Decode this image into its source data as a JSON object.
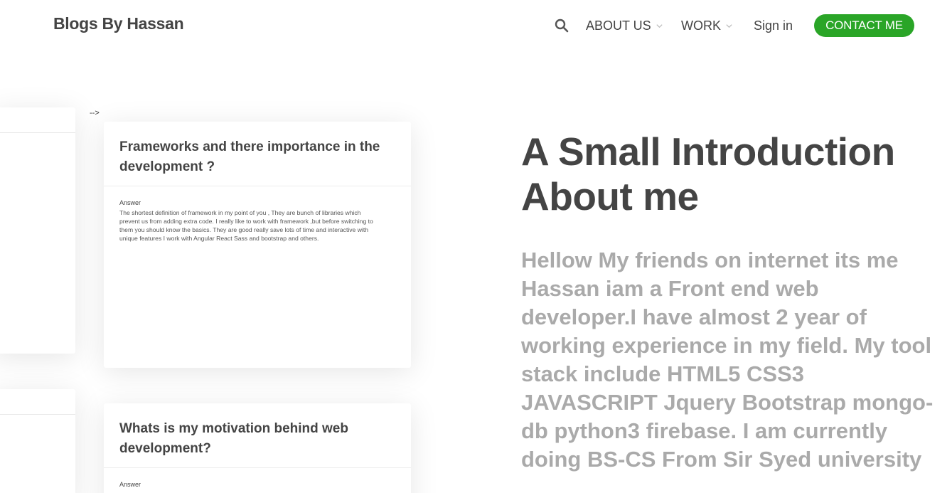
{
  "header": {
    "brand": "Blogs By Hassan",
    "nav": {
      "about": "ABOUT US",
      "work": "WORK",
      "signin": "Sign in",
      "contact": "CONTACT ME"
    }
  },
  "stray_text": "-->",
  "cards": [
    {
      "title": "Frameworks and there importance in the development ?",
      "answer_label": "Answer",
      "answer": "The shortest definition of framework in my point of you , They are bunch of libraries which prevent us from adding extra code. I really like to work with framework ,but before switching to them you should know the basics. They are good really save lots of time and interactive with unique features I work with Angular React Sass and bootstrap and others."
    },
    {
      "title": "Whats is my motivation behind web development?",
      "answer_label": "Answer"
    }
  ],
  "intro": {
    "title": "A Small Introduction About me",
    "text": "Hellow My friends on internet its me Hassan iam a Front end web developer.I have almost 2 year of working experience in my field. My tool stack include HTML5 CSS3 JAVASCRIPT Jquery Bootstrap mongo-db python3 firebase. I am currently doing BS-CS From Sir Syed university"
  },
  "colors": {
    "accent": "#2aa527",
    "text": "#444444",
    "muted": "#aaaaaa"
  }
}
